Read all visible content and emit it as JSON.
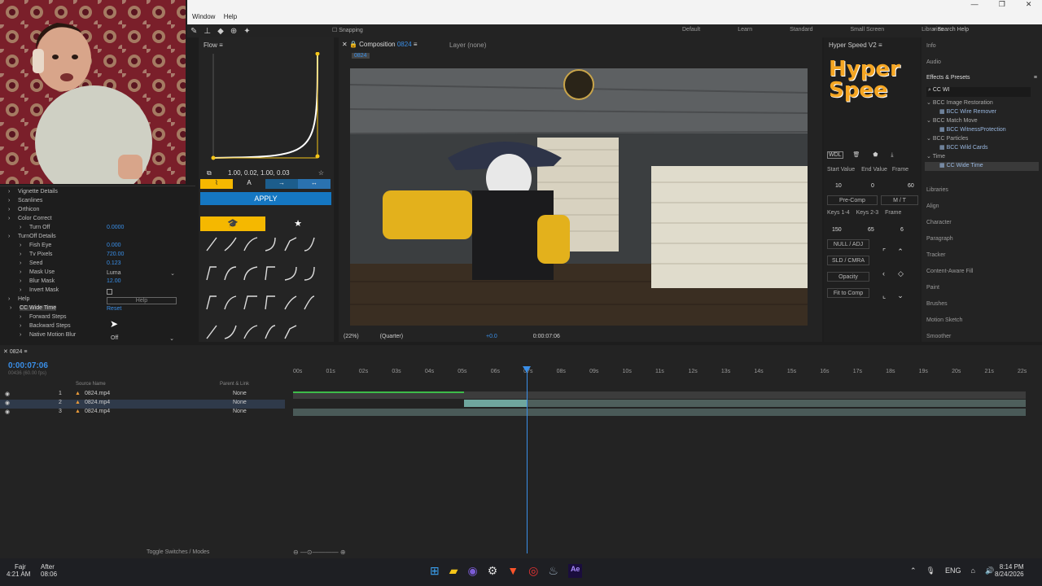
{
  "window_menu": [
    "Window",
    "Help"
  ],
  "workspaces": [
    "Default",
    "Learn",
    "Standard",
    "Small Screen",
    "Libraries"
  ],
  "search_help": "Search Help",
  "snapping": "Snapping",
  "effects_controls": {
    "rows": [
      {
        "label": "Vignette Details",
        "value": ""
      },
      {
        "label": "Scanlines",
        "value": ""
      },
      {
        "label": "Orthicon",
        "value": ""
      },
      {
        "label": "Color Correct",
        "value": ""
      },
      {
        "label": "Turn Off",
        "value": "0.0000"
      },
      {
        "label": "TurnOff Details",
        "value": ""
      },
      {
        "label": "Fish Eye",
        "value": "0.000"
      },
      {
        "label": "Tv Pixels",
        "value": "720.00"
      },
      {
        "label": "Seed",
        "value": "0.123"
      },
      {
        "label": "Mask Use",
        "value": "Luma"
      },
      {
        "label": "Blur Mask",
        "value": "12.00"
      },
      {
        "label": "Invert Mask",
        "value": ""
      },
      {
        "label": "Help",
        "value": "Help"
      },
      {
        "label": "CC Wide Time",
        "value": "Reset"
      },
      {
        "label": "Forward Steps",
        "value": ""
      },
      {
        "label": "Backward Steps",
        "value": ""
      },
      {
        "label": "Native Motion Blur",
        "value": "Off"
      }
    ]
  },
  "flow": {
    "title": "Flow",
    "bezier": "1.00, 0.02, 1.00, 0.03",
    "apply": "APPLY"
  },
  "composition": {
    "tab": "Composition",
    "tab_name": "0824",
    "layer_tab": "Layer (none)",
    "zoom": "(22%)",
    "resolution": "(Quarter)",
    "timecode": "0:00:07:06",
    "exposure": "+0.0"
  },
  "hyper_speed": {
    "title": "Hyper Speed V2",
    "logo": "Hyper Spee",
    "start_value_label": "Start Value",
    "end_value_label": "End Value",
    "frame_label": "Frame",
    "start_value": "10",
    "end_value": "0",
    "frame": "60",
    "precomp": "Pre-Comp",
    "mt": "M / T",
    "keys14": "Keys 1-4",
    "keys23": "Keys 2-3",
    "frame2": "Frame",
    "k1": "150",
    "k2": "65",
    "k3": "6",
    "null_adj": "NULL / ADJ",
    "sld_cmra": "SLD / CMRA",
    "opacity": "Opacity",
    "fit": "Fit to Comp",
    "wdl": "WDL"
  },
  "effects_presets": {
    "tabs_top": [
      "Info",
      "Audio"
    ],
    "title": "Effects & Presets",
    "search": "CC WI",
    "tree": [
      {
        "label": "BCC Image Restoration",
        "indent": 0
      },
      {
        "label": "BCC Wire Remover",
        "indent": 1
      },
      {
        "label": "BCC Match Move",
        "indent": 0
      },
      {
        "label": "BCC WitnessProtection",
        "indent": 1
      },
      {
        "label": "BCC Particles",
        "indent": 0
      },
      {
        "label": "BCC Wild Cards",
        "indent": 1
      },
      {
        "label": "Time",
        "indent": 0
      },
      {
        "label": "CC Wide Time",
        "indent": 1
      }
    ],
    "panels": [
      "Libraries",
      "Align",
      "Character",
      "Paragraph",
      "Tracker",
      "Content-Aware Fill",
      "Paint",
      "Brushes",
      "Motion Sketch",
      "Smoother"
    ]
  },
  "timeline": {
    "comp_name": "0824",
    "timecode": "0:00:07:06",
    "fps": "00436 (60.00 fps)",
    "source_name_header": "Source Name",
    "parent_header": "Parent & Link",
    "ruler": [
      "00s",
      "01s",
      "02s",
      "03s",
      "04s",
      "05s",
      "06s",
      "07s",
      "08s",
      "09s",
      "10s",
      "11s",
      "12s",
      "13s",
      "14s",
      "15s",
      "16s",
      "17s",
      "18s",
      "19s",
      "20s",
      "21s",
      "22s"
    ],
    "layers": [
      {
        "num": "1",
        "name": "0824.mp4",
        "parent": "None"
      },
      {
        "num": "2",
        "name": "0824.mp4",
        "parent": "None"
      },
      {
        "num": "3",
        "name": "0824.mp4",
        "parent": "None"
      }
    ],
    "toggle": "Toggle Switches / Modes"
  },
  "taskbar": {
    "weather_title": "Fajr",
    "weather_time": "4:21 AM",
    "weather_after": "After",
    "weather_count": "08:06",
    "lang": "ENG",
    "time": "8:14 PM",
    "date": "8/24/2026"
  }
}
